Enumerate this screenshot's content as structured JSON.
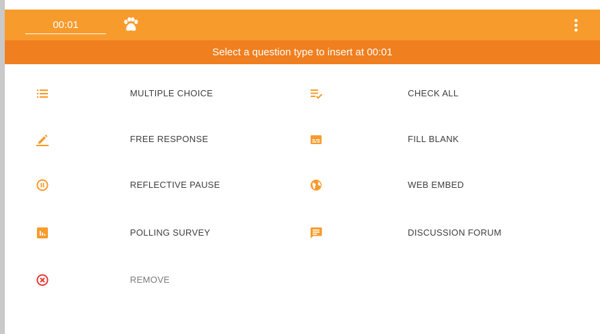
{
  "colors": {
    "accent": "#f89b2d",
    "banner": "#f07f1f",
    "remove": "#e53935",
    "label": "#3d3d3d"
  },
  "header": {
    "time": "00:01",
    "logo_icon": "paw-icon",
    "menu_icon": "more-vertical-icon"
  },
  "banner": {
    "text": "Select a question type to insert at 00:01"
  },
  "options": [
    {
      "label": "MULTIPLE CHOICE",
      "icon": "list-icon"
    },
    {
      "label": "CHECK ALL",
      "icon": "list-check-icon"
    },
    {
      "label": "FREE RESPONSE",
      "icon": "pencil-icon"
    },
    {
      "label": "FILL BLANK",
      "icon": "text-box-icon"
    },
    {
      "label": "REFLECTIVE PAUSE",
      "icon": "pause-circle-icon"
    },
    {
      "label": "WEB EMBED",
      "icon": "globe-icon"
    },
    {
      "label": "POLLING SURVEY",
      "icon": "poll-icon"
    },
    {
      "label": "DISCUSSION FORUM",
      "icon": "chat-icon"
    },
    {
      "label": "REMOVE",
      "icon": "close-circle-icon"
    }
  ]
}
